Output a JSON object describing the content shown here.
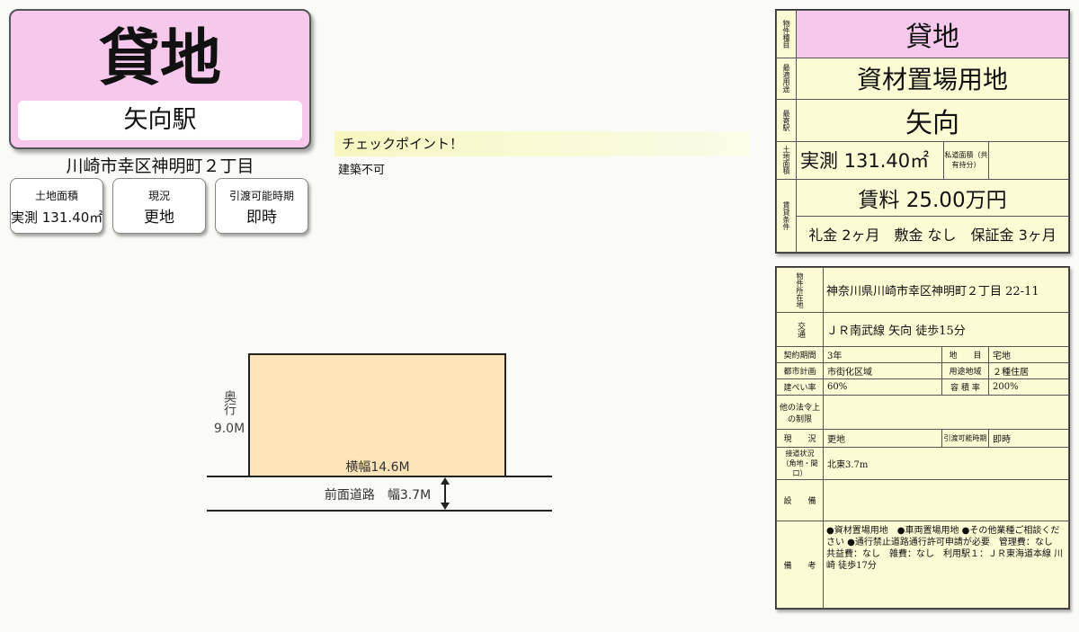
{
  "title_card": {
    "type": "貸地",
    "station": "矢向駅"
  },
  "address_short": "川崎市幸区神明町２丁目",
  "info_cards": [
    {
      "label": "土地面積",
      "value": "実測 131.40㎡"
    },
    {
      "label": "現況",
      "value": "更地"
    },
    {
      "label": "引渡可能時期",
      "value": "即時"
    }
  ],
  "checkpoint": {
    "title": "チェックポイント！",
    "text": "建築不可"
  },
  "diagram": {
    "depth_label": "奥行",
    "depth_value": "9.0M",
    "width_label": "横幅14.6M",
    "road_label": "前面道路　幅3.7M"
  },
  "summary": {
    "type_label": "物件種目",
    "type": "貸地",
    "use_label": "最適用途",
    "use": "資材置場用地",
    "station_label": "最寄駅",
    "station": "矢向",
    "area_label": "土地面積",
    "area": "実測 131.40㎡",
    "private_road_label": "私道面積（共有持分）",
    "private_road_value": "",
    "rent_label": "賃貸条件",
    "rent": "賃料 25.00万円",
    "terms": "礼金 2ヶ月　敷金 なし　保証金 3ヶ月"
  },
  "detail": {
    "location_label": "物件所在地",
    "location": "神奈川県川崎市幸区神明町２丁目 22-11",
    "transport_label": "交通",
    "transport": "ＪＲ南武線 矢向 徒歩15分",
    "contract_label": "契約期間",
    "contract": "3年",
    "land_cat_label": "地　　目",
    "land_cat": "宅地",
    "city_plan_label": "都市計画",
    "city_plan": "市街化区域",
    "zoning_label": "用途地域",
    "zoning": "２種住居",
    "bcr_label": "建ぺい率",
    "bcr": "60%",
    "far_label": "容 積 率",
    "far": "200%",
    "other_label": "他の法令上の制限",
    "other": "",
    "status_label": "現　　況",
    "status": "更地",
    "handover_label": "引渡可能時期",
    "handover": "即時",
    "road_label": "接道状況（角地・間口）",
    "road": "北東3.7m",
    "equip_label": "設　　備",
    "equip": "",
    "remarks_label": "備　　考",
    "remarks": "●資材置場用地　●車両置場用地 ●その他業種ご相談ください ●通行禁止道路通行許可申請が必要　管理費：なし　共益費：なし　雑費：なし　利用駅１：ＪＲ東海道本線 川崎 徒歩17分"
  }
}
